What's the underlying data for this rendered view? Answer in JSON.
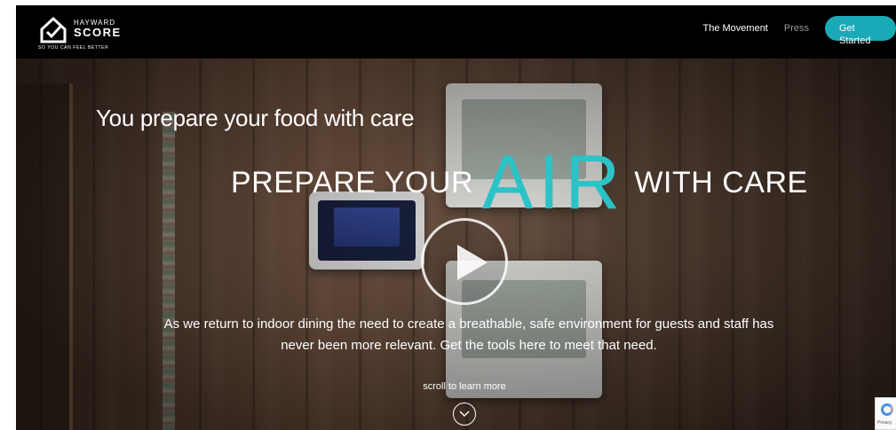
{
  "header": {
    "logo": {
      "top_text": "HAYWARD",
      "main_text": "SCORE",
      "tagline": "SO YOU CAN FEEL BETTER"
    },
    "nav": {
      "movement": "The Movement",
      "press": "Press",
      "cta": "Get Started"
    }
  },
  "hero": {
    "line1": "You prepare your food with care",
    "line2_a": "PREPARE YOUR",
    "line2_air": "AIR",
    "line2_b": "WITH CARE",
    "description": "As we return to indoor dining the need to create a breathable, safe environment for guests and staff has never been more relevant. Get the tools here to meet that need.",
    "scroll_text": "scroll to learn more"
  },
  "recaptcha": {
    "label": "Privacy"
  },
  "colors": {
    "accent": "#1aa9b6",
    "air_text": "#2bc3c6",
    "header_bg": "#000000"
  },
  "icons": [
    "house-check-logo-icon",
    "play-icon",
    "chevron-down-icon",
    "recaptcha-icon"
  ]
}
